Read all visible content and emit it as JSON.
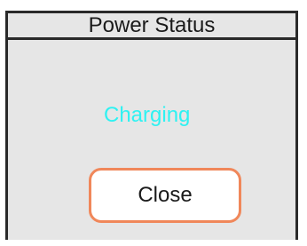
{
  "window": {
    "title": "Power Status"
  },
  "status": {
    "text": "Charging",
    "color": "#2ef2f2"
  },
  "actions": {
    "close_label": "Close",
    "close_border_color": "#f0875a"
  }
}
